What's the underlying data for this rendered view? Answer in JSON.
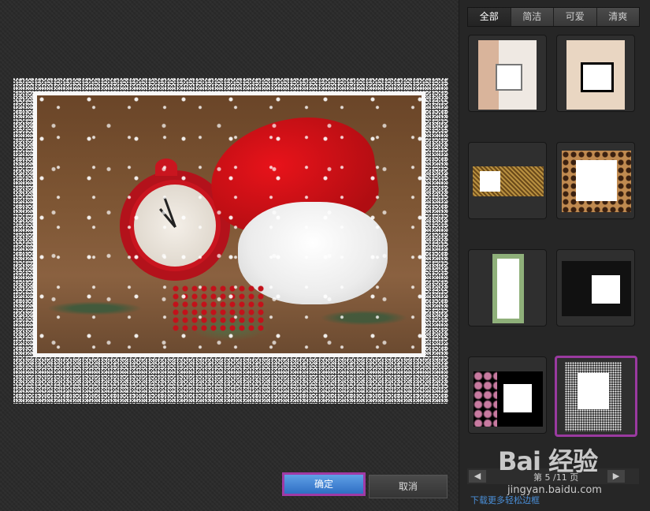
{
  "preview": {
    "image_description_icon": "christmas-photo"
  },
  "buttons": {
    "ok": "确定",
    "cancel": "取消"
  },
  "tabs": [
    {
      "label": "全部",
      "active": true
    },
    {
      "label": "简洁",
      "active": false
    },
    {
      "label": "可爱",
      "active": false
    },
    {
      "label": "清爽",
      "active": false
    }
  ],
  "pager": {
    "prefix": "第",
    "current": "5",
    "suffix": "/11 页",
    "prev_icon": "arrow-left-icon",
    "next_icon": "arrow-right-icon"
  },
  "download_link": "下载更多轻松边框",
  "watermark": {
    "logo": "Bai 经验",
    "url": "jingyan.baidu.com"
  },
  "colors": {
    "selected_border": "#9a3aa0",
    "ok_button": "#2f6fc4",
    "link": "#4a8fd8"
  }
}
